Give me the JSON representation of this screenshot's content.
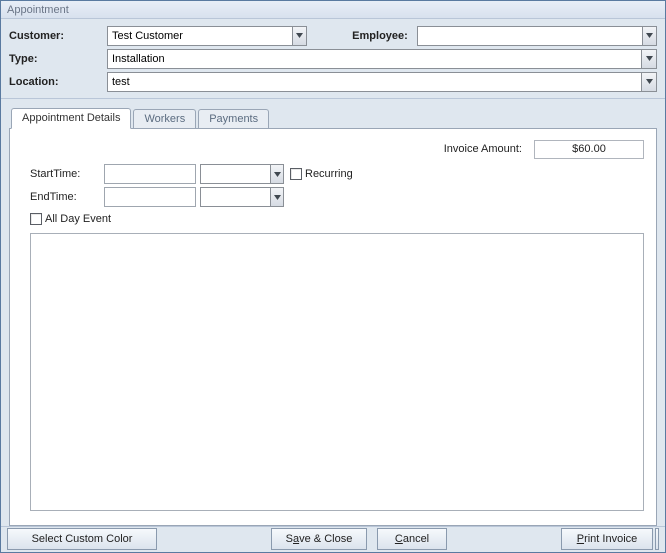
{
  "window": {
    "title": "Appointment"
  },
  "header": {
    "customer_label": "Customer:",
    "customer_value": "Test Customer",
    "employee_label": "Employee:",
    "employee_value": "",
    "type_label": "Type:",
    "type_value": "Installation",
    "location_label": "Location:",
    "location_value": "test"
  },
  "tabs": {
    "details": "Appointment Details",
    "workers": "Workers",
    "payments": "Payments"
  },
  "details": {
    "invoice_label": "Invoice Amount:",
    "invoice_value": "$60.00",
    "start_label": "StartTime:",
    "start_date": "",
    "start_time": "",
    "end_label": "EndTime:",
    "end_date": "",
    "end_time": "",
    "recurring_label": "Recurring",
    "allday_label": "All Day Event",
    "notes": ""
  },
  "buttons": {
    "select_color": "Select Custom Color",
    "save_close_pre": "S",
    "save_close_ul": "a",
    "save_close_post": "ve & Close",
    "cancel_ul": "C",
    "cancel_post": "ancel",
    "print_ul": "P",
    "print_post": "rint Invoice"
  }
}
